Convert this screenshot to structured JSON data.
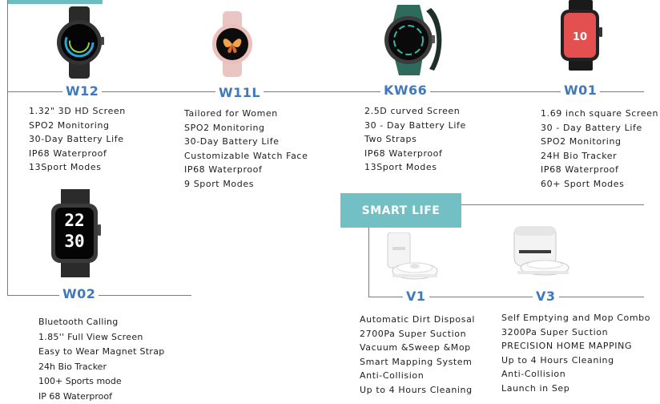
{
  "products": {
    "w12": {
      "name": "W12",
      "specs": [
        "1.32\" 3D HD Screen",
        "SPO2 Monitoring",
        "30-Day Battery Life",
        "IP68 Waterproof",
        "13Sport Modes"
      ]
    },
    "w11l": {
      "name": "W11L",
      "specs": [
        "Tailored for Women",
        "SPO2 Monitoring",
        "30-Day Battery Life",
        "Customizable Watch Face",
        "IP68 Waterproof",
        "9 Sport Modes"
      ]
    },
    "kw66": {
      "name": "KW66",
      "specs": [
        "2.5D curved Screen",
        "30 - Day Battery Life",
        "Two Straps",
        "IP68 Waterproof",
        "13Sport Modes"
      ]
    },
    "w01": {
      "name": "W01",
      "specs": [
        "1.69 inch square Screen",
        "30 - Day Battery Life",
        "SPO2 Monitoring",
        "24H Bio Tracker",
        "IP68 Waterproof",
        "60+ Sport Modes"
      ]
    },
    "w02": {
      "name": "W02",
      "display_time": [
        "22",
        "30"
      ],
      "specs": [
        "Bluetooth Calling",
        "1.85'' Full View Screen",
        "Easy to Wear Magnet Strap",
        "24h Bio Tracker",
        "100+ Sports mode",
        "IP 68 Waterproof"
      ]
    },
    "v1": {
      "name": "V1",
      "specs": [
        "Automatic Dirt Disposal",
        "2700Pa Super Suction",
        "Vacuum &Sweep &Mop",
        "Smart Mapping System",
        "Anti-Collision",
        "Up to 4 Hours Cleaning"
      ]
    },
    "v3": {
      "name": "V3",
      "specs": [
        "Self Emptying and Mop Combo",
        "3200Pa Super Suction",
        "PRECISION HOME MAPPING",
        "Up to 4 Hours Cleaning",
        "Anti-Collision",
        "Launch in Sep"
      ]
    }
  },
  "smart_life": {
    "label": "SMART LIFE"
  },
  "colors": {
    "accent": "#72c0c3",
    "model_blue": "#3f79bd",
    "line_gray": "#7c7c7c"
  },
  "icons": [
    "round-smartwatch-icon",
    "pink-smartwatch-icon",
    "green-smartwatch-icon",
    "square-smartwatch-icon",
    "digital-smartwatch-icon",
    "robot-vacuum-icon",
    "robot-vacuum-station-icon"
  ]
}
